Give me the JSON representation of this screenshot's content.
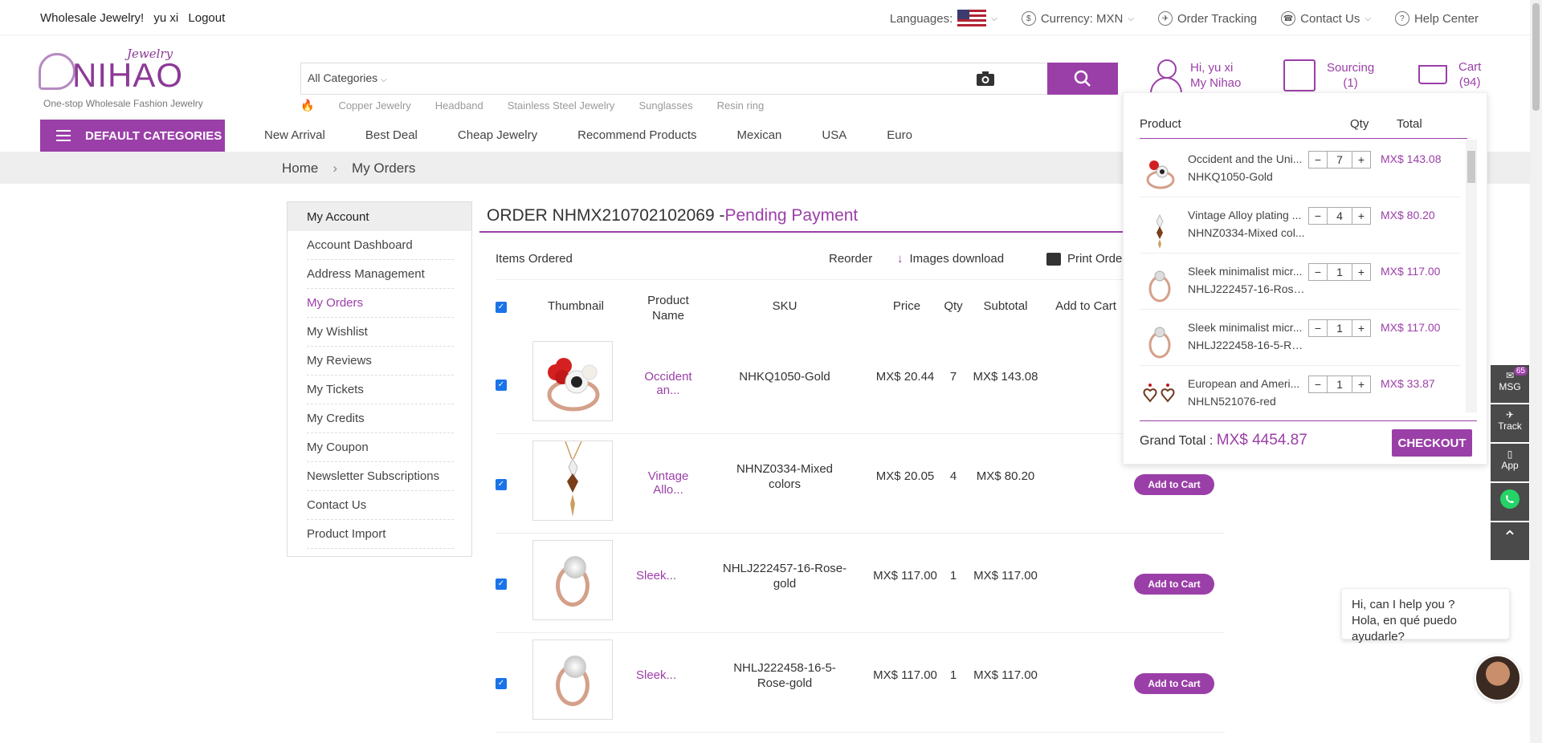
{
  "topbar": {
    "welcome": "Wholesale Jewelry!",
    "user": "yu xi",
    "logout": "Logout",
    "languages_label": "Languages:",
    "currency": "Currency: MXN",
    "order_tracking": "Order Tracking",
    "contact_us": "Contact Us",
    "help_center": "Help Center"
  },
  "logo": {
    "brand": "NIHAO",
    "script": "Jewelry",
    "tagline": "One-stop Wholesale Fashion Jewelry"
  },
  "search": {
    "category": "All Categories",
    "hot_terms": [
      "Copper Jewelry",
      "Headband",
      "Stainless Steel Jewelry",
      "Sunglasses",
      "Resin ring"
    ]
  },
  "account": {
    "greeting": "Hi, yu xi",
    "my_nihao": "My Nihao",
    "sourcing": "Sourcing",
    "sourcing_count": "(1)",
    "cart": "Cart",
    "cart_count": "(94)"
  },
  "nav": {
    "default_categories": "DEFAULT CATEGORIES",
    "links": [
      "New Arrival",
      "Best Deal",
      "Cheap Jewelry",
      "Recommend Products",
      "Mexican",
      "USA",
      "Euro"
    ]
  },
  "breadcrumb": {
    "home": "Home",
    "current": "My Orders"
  },
  "sidebar": {
    "title": "My Account",
    "items": [
      {
        "label": "Account Dashboard"
      },
      {
        "label": "Address Management"
      },
      {
        "label": "My Orders"
      },
      {
        "label": "My Wishlist"
      },
      {
        "label": "My Reviews"
      },
      {
        "label": "My Tickets"
      },
      {
        "label": "My Credits"
      },
      {
        "label": "My Coupon"
      },
      {
        "label": "Newsletter Subscriptions"
      },
      {
        "label": "Contact Us"
      },
      {
        "label": "Product Import"
      }
    ]
  },
  "order": {
    "title_prefix": "ORDER NHMX210702102069 -",
    "status": "Pending Payment",
    "items_ordered": "Items Ordered",
    "reorder": "Reorder",
    "images_download": "Images download",
    "print_order": "Print Order"
  },
  "table": {
    "headers": {
      "thumbnail": "Thumbnail",
      "product_name": "Product Name",
      "sku": "SKU",
      "price": "Price",
      "qty": "Qty",
      "subtotal": "Subtotal",
      "add_to_cart": "Add to Cart"
    },
    "add_to_cart_label": "Add to Cart",
    "rows": [
      {
        "name": "Occident an...",
        "sku": "NHKQ1050-Gold",
        "price": "MX$ 20.44",
        "qty": "7",
        "subtotal": "MX$ 143.08"
      },
      {
        "name": "Vintage Allo...",
        "sku": "NHNZ0334-Mixed colors",
        "price": "MX$ 20.05",
        "qty": "4",
        "subtotal": "MX$ 80.20"
      },
      {
        "name": "Sleek...",
        "sku": "NHLJ222457-16-Rose-gold",
        "price": "MX$ 117.00",
        "qty": "1",
        "subtotal": "MX$ 117.00"
      },
      {
        "name": "Sleek...",
        "sku": "NHLJ222458-16-5-Rose-gold",
        "price": "MX$ 117.00",
        "qty": "1",
        "subtotal": "MX$ 117.00"
      }
    ]
  },
  "cart_popup": {
    "headers": {
      "product": "Product",
      "qty": "Qty",
      "total": "Total"
    },
    "items": [
      {
        "name": "Occident and the Uni...",
        "sku": "NHKQ1050-Gold",
        "qty": "7",
        "total": "MX$ 143.08"
      },
      {
        "name": "Vintage Alloy plating ...",
        "sku": "NHNZ0334-Mixed col...",
        "qty": "4",
        "total": "MX$ 80.20"
      },
      {
        "name": "Sleek minimalist micr...",
        "sku": "NHLJ222457-16-Rose...",
        "qty": "1",
        "total": "MX$ 117.00"
      },
      {
        "name": "Sleek minimalist micr...",
        "sku": "NHLJ222458-16-5-Ro...",
        "qty": "1",
        "total": "MX$ 117.00"
      },
      {
        "name": "European and Ameri...",
        "sku": "NHLN521076-red",
        "qty": "1",
        "total": "MX$ 33.87"
      }
    ],
    "grand_total_label": "Grand Total :",
    "grand_total": "MX$ 4454.87",
    "checkout": "CHECKOUT"
  },
  "dock": {
    "msg": "MSG",
    "msg_badge": "65",
    "track": "Track",
    "app": "App"
  },
  "chat": {
    "line1": "Hi, can I help you ?",
    "line2": "Hola, en qué puedo ayudarle?"
  },
  "colors": {
    "brand": "#9b3fa8",
    "checkbox": "#1a73e8"
  }
}
